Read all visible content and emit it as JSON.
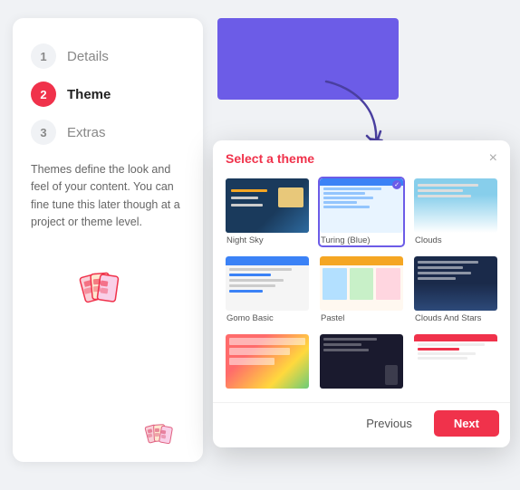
{
  "steps": [
    {
      "number": "1",
      "label": "Details",
      "state": "inactive"
    },
    {
      "number": "2",
      "label": "Theme",
      "state": "active"
    },
    {
      "number": "3",
      "label": "Extras",
      "state": "inactive"
    }
  ],
  "description": "Themes define the look and feel of your content. You can fine tune this later though at a project or theme level.",
  "modal": {
    "title": "Select a theme",
    "close_label": "×",
    "themes": [
      {
        "name": "Night Sky",
        "type": "nightsky",
        "selected": false
      },
      {
        "name": "Turing (Blue)",
        "type": "turing",
        "selected": true
      },
      {
        "name": "Clouds",
        "type": "clouds",
        "selected": false
      },
      {
        "name": "Gomo Basic",
        "type": "gomo",
        "selected": false
      },
      {
        "name": "Pastel",
        "type": "pastel",
        "selected": false
      },
      {
        "name": "Clouds And Stars",
        "type": "cloudstars",
        "selected": false
      },
      {
        "name": "",
        "type": "colorful",
        "selected": false
      },
      {
        "name": "",
        "type": "dark",
        "selected": false
      },
      {
        "name": "",
        "type": "modern",
        "selected": false
      }
    ],
    "footer": {
      "previous_label": "Previous",
      "next_label": "Next"
    }
  }
}
